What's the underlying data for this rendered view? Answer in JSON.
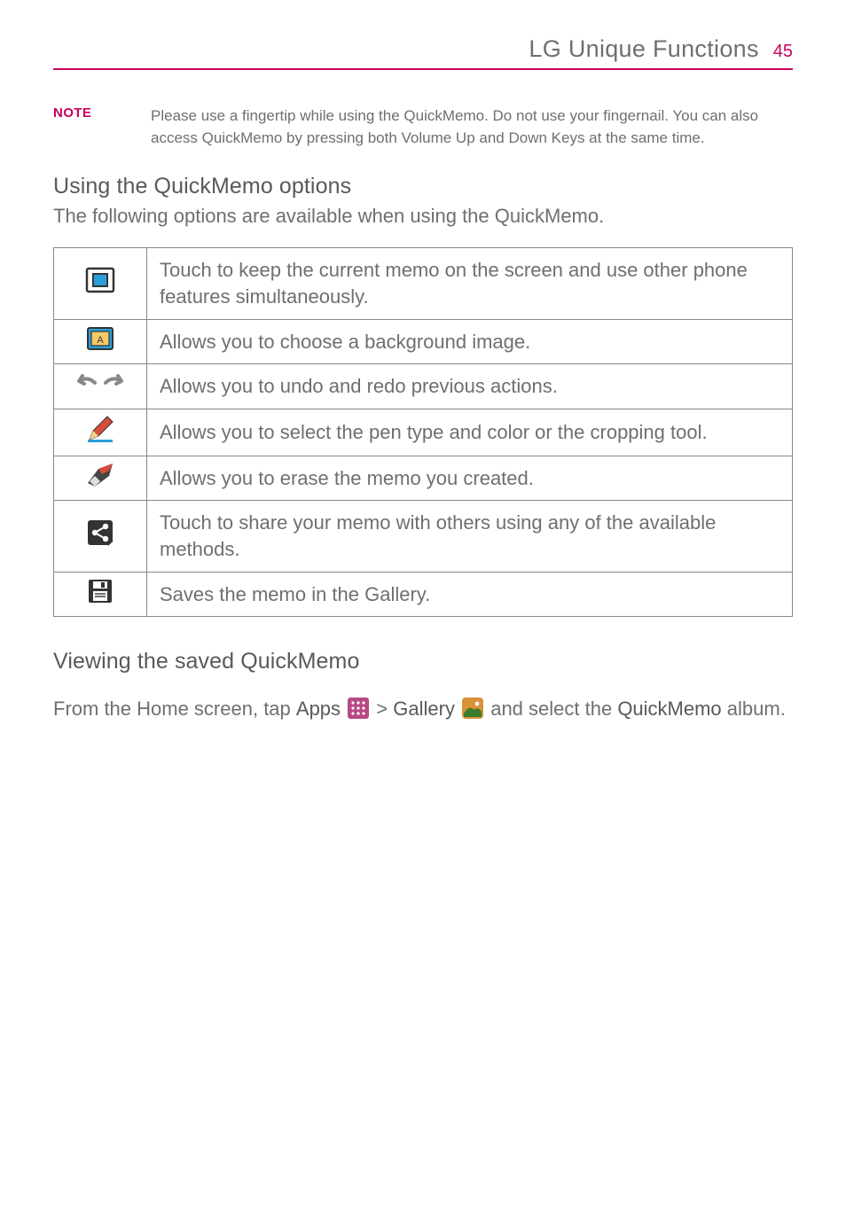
{
  "header": {
    "title": "LG Unique Functions",
    "page_number": "45"
  },
  "note": {
    "label": "NOTE",
    "text": "Please use a fingertip while using the QuickMemo. Do not use your fingernail. You can also access QuickMemo by pressing both Volume Up and Down Keys at the same time."
  },
  "options_section": {
    "heading": "Using the QuickMemo options",
    "intro": "The following options are available when using the QuickMemo.",
    "rows": [
      {
        "icon": "overlay-window-icon",
        "desc": "Touch to keep the current memo on the screen and use other phone features simultaneously."
      },
      {
        "icon": "background-image-icon",
        "desc": "Allows you to choose a background image."
      },
      {
        "icon": "undo-redo-icon",
        "desc": "Allows you to undo and redo previous actions."
      },
      {
        "icon": "pen-icon",
        "desc": "Allows you to select the pen type and color or the cropping tool."
      },
      {
        "icon": "eraser-icon",
        "desc": "Allows you to erase the memo you created."
      },
      {
        "icon": "share-icon",
        "desc": "Touch to share your memo with others using any of the available methods."
      },
      {
        "icon": "save-icon",
        "desc": "Saves the memo in the Gallery."
      }
    ]
  },
  "view_section": {
    "heading": "Viewing the saved QuickMemo",
    "parts": {
      "t1": "From the Home screen, tap ",
      "apps": "Apps",
      "gt": " > ",
      "gallery": "Gallery",
      "t2": " and select the ",
      "album": "QuickMemo",
      "t3": " album."
    }
  }
}
